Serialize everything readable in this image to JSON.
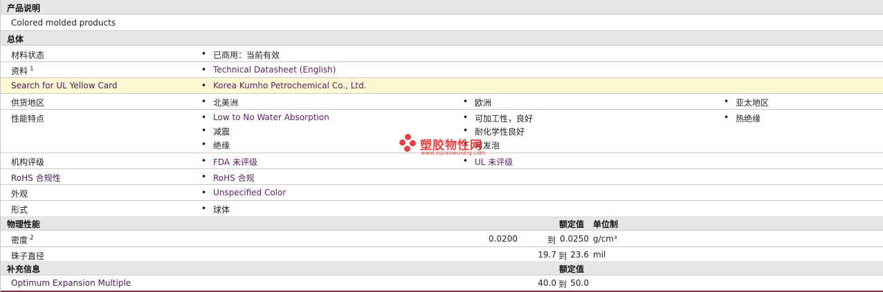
{
  "sections": {
    "product_desc": "产品说明",
    "general": "总体",
    "physical": "物理性能",
    "supplemental": "补充信息"
  },
  "product_desc": {
    "text": "Colored molded products"
  },
  "general": {
    "material_status": {
      "label": "材料状态",
      "value": "已商用：当前有效"
    },
    "documents": {
      "label": "资料",
      "sup": "1",
      "value": "Technical Datasheet (English)"
    },
    "ul_card": {
      "label": "Search for UL Yellow Card",
      "value": "Korea Kumho Petrochemical Co., Ltd."
    },
    "supply": {
      "label": "供货地区",
      "values": [
        "北美洲",
        "欧洲",
        "亚太地区"
      ]
    },
    "features": {
      "label": "性能特点",
      "col1": [
        "Low to No Water Absorption",
        "减震",
        "绝缘"
      ],
      "col2": [
        "可加工性，良好",
        "耐化学性良好",
        "可发泡"
      ],
      "col3": [
        "热绝缘"
      ]
    },
    "agency": {
      "label": "机构评级",
      "values": [
        "FDA 未评级",
        "UL 未评级"
      ]
    },
    "rohs": {
      "label": "RoHS 合规性",
      "value": "RoHS 合规"
    },
    "appearance": {
      "label": "外观",
      "value": "Unspecified Color"
    },
    "form": {
      "label": "形式",
      "value": "球体"
    }
  },
  "physical": {
    "col_nominal": "额定值",
    "col_unit": "单位制",
    "density": {
      "label": "密度",
      "sup": "2",
      "from": "0.0200",
      "to_word": "到",
      "to": "0.0250",
      "unit": "g/cm³"
    },
    "bead_diameter": {
      "label": "珠子直径",
      "from": "19.7",
      "to_word": "到",
      "to": "23.6",
      "unit": "mil"
    }
  },
  "supplemental": {
    "col_nominal": "额定值",
    "expansion": {
      "label": "Optimum Expansion Multiple",
      "from": "40.0",
      "to_word": "到",
      "to": "50.0"
    }
  },
  "watermark": {
    "title": "塑胶物性网",
    "url": "www.sujiaowuxing.com"
  }
}
